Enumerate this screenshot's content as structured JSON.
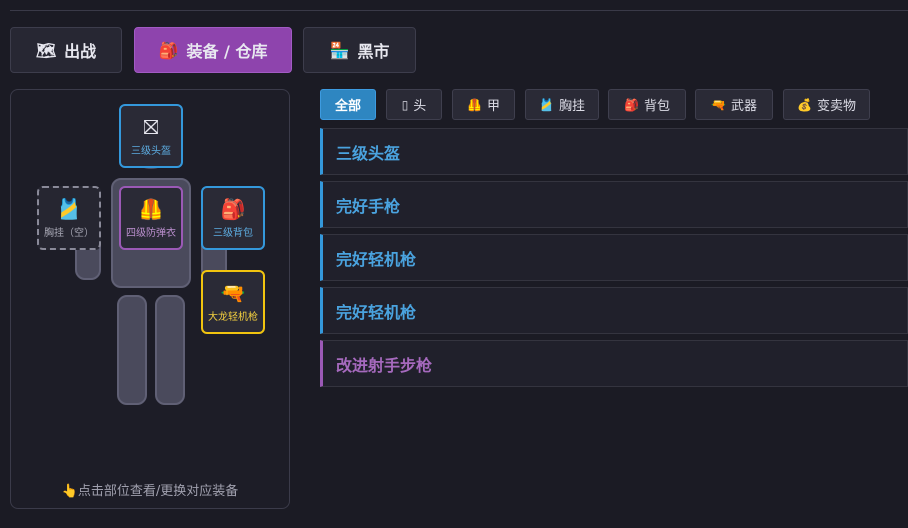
{
  "tabs": [
    {
      "label": "出战",
      "icon": "map-icon",
      "glyph": "🗺",
      "active": false
    },
    {
      "label": "装备 / 仓库",
      "icon": "backpack-icon",
      "glyph": "🎒",
      "active": true
    },
    {
      "label": "黑市",
      "icon": "shop-icon",
      "glyph": "🏪",
      "active": false
    }
  ],
  "slots": {
    "helmet": {
      "label": "三级头盔",
      "glyph": "⛝",
      "icon": "helmet-icon"
    },
    "chest_rig": {
      "label": "胸挂（空）",
      "glyph": "🎽",
      "icon": "chest-rig-icon"
    },
    "armor": {
      "label": "四级防弹衣",
      "glyph": "🦺",
      "icon": "armor-vest-icon"
    },
    "backpack": {
      "label": "三级背包",
      "glyph": "🎒",
      "icon": "backpack-icon"
    },
    "weapon": {
      "label": "大龙轻机枪",
      "glyph": "🔫",
      "icon": "gun-icon"
    }
  },
  "hint": {
    "text": "点击部位查看/更换对应装备",
    "glyph": "👆",
    "icon": "pointing-hand-icon"
  },
  "filters": [
    {
      "label": "全部",
      "glyph": "",
      "icon": "",
      "active": true
    },
    {
      "label": "头",
      "glyph": "▯",
      "icon": "helmet-icon",
      "active": false
    },
    {
      "label": "甲",
      "glyph": "🦺",
      "icon": "armor-vest-icon",
      "active": false
    },
    {
      "label": "胸挂",
      "glyph": "🎽",
      "icon": "chest-rig-icon",
      "active": false
    },
    {
      "label": "背包",
      "glyph": "🎒",
      "icon": "backpack-icon",
      "active": false
    },
    {
      "label": "武器",
      "glyph": "🔫",
      "icon": "gun-icon",
      "active": false
    },
    {
      "label": "变卖物",
      "glyph": "💰",
      "icon": "money-bag-icon",
      "active": false
    }
  ],
  "items": [
    {
      "name": "三级头盔",
      "rarity_color": "#3498db"
    },
    {
      "name": "完好手枪",
      "rarity_color": "#3498db"
    },
    {
      "name": "完好轻机枪",
      "rarity_color": "#3498db"
    },
    {
      "name": "完好轻机枪",
      "rarity_color": "#3498db"
    },
    {
      "name": "改进射手步枪",
      "rarity_color": "#9b59b6"
    }
  ],
  "colors": {
    "accent_purple": "#8e44ad",
    "accent_blue": "#2e86c1",
    "rarity_blue": "#3498db",
    "rarity_purple": "#9b59b6",
    "rarity_gold": "#f1c40f"
  }
}
